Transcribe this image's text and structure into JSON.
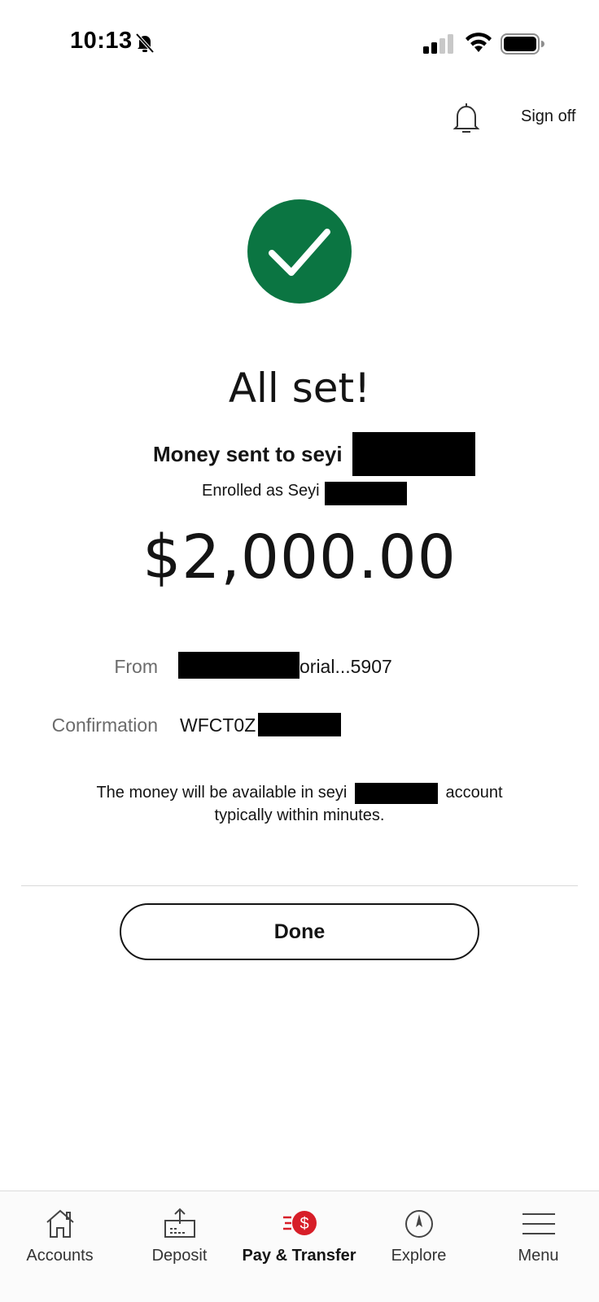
{
  "status_bar": {
    "time": "10:13",
    "icons": [
      "bell-slash-icon",
      "cellular-signal-icon",
      "wifi-icon",
      "battery-icon"
    ]
  },
  "header": {
    "notification_icon": "bell-icon",
    "sign_off_label": "Sign off"
  },
  "confirmation": {
    "status_icon": "check-circle-icon",
    "accent_color": "#0b7542",
    "title": "All set!",
    "recipient_text": "Money sent to seyi",
    "enrolled_text": "Enrolled as Seyi",
    "amount": "$2,000.00",
    "from_label": "From",
    "from_value": "orial...5907",
    "confirmation_label": "Confirmation",
    "confirmation_value": "WFCT0Z",
    "note_line1_start": "The money will be available in seyi",
    "note_line1_end": "account",
    "note_line2": "typically within minutes.",
    "done_label": "Done"
  },
  "bottom_nav": {
    "active_color": "#d71e28",
    "items": [
      {
        "label": "Accounts",
        "icon": "home-icon"
      },
      {
        "label": "Deposit",
        "icon": "deposit-icon"
      },
      {
        "label": "Pay & Transfer",
        "icon": "pay-transfer-icon",
        "active": true
      },
      {
        "label": "Explore",
        "icon": "compass-icon"
      },
      {
        "label": "Menu",
        "icon": "hamburger-menu-icon"
      }
    ]
  }
}
